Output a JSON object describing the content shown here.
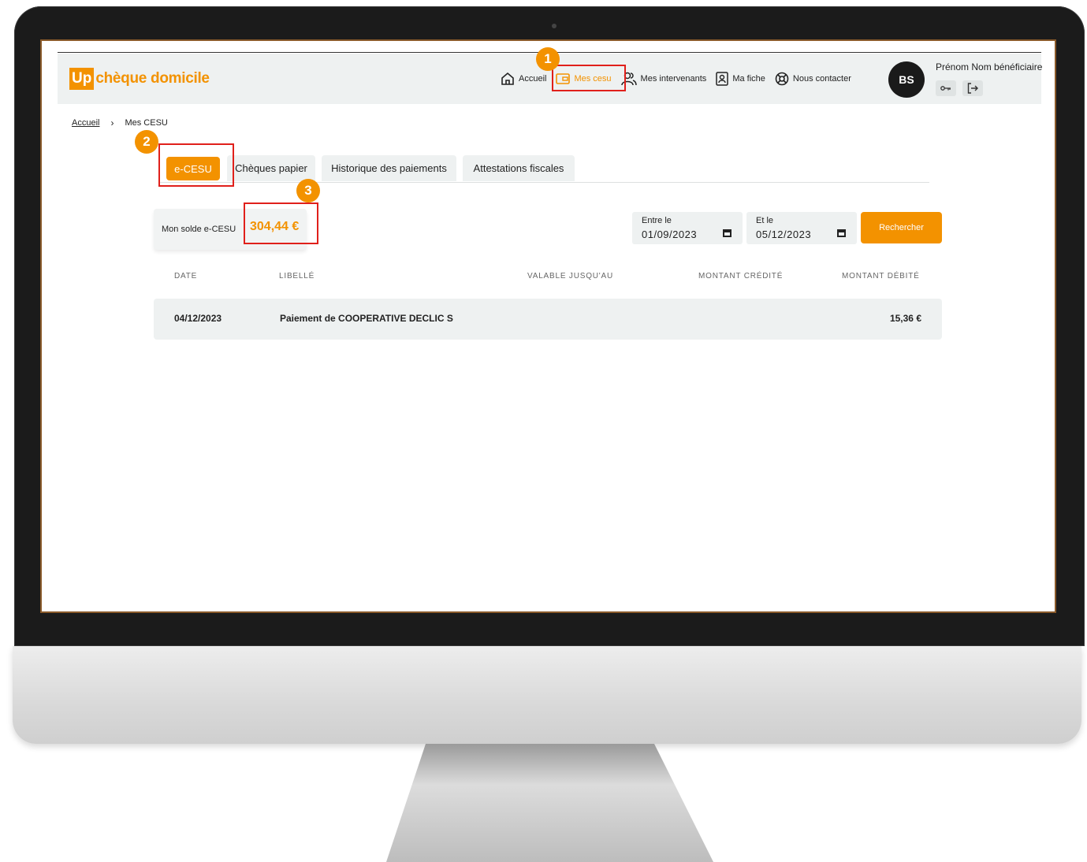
{
  "colors": {
    "accent": "#f39200",
    "header_bg": "#eef1f1",
    "annotation": "#e0201b"
  },
  "logo": {
    "up": "Up",
    "text": "chèque domicile"
  },
  "nav": [
    {
      "label": "Accueil",
      "icon": "home-icon"
    },
    {
      "label": "Mes cesu",
      "icon": "wallet-icon",
      "active": true
    },
    {
      "label": "Mes intervenants",
      "icon": "users-icon"
    },
    {
      "label": "Ma fiche",
      "icon": "contact-card-icon"
    },
    {
      "label": "Nous contacter",
      "icon": "lifebuoy-icon"
    }
  ],
  "user": {
    "initials": "BS",
    "name": "Prénom Nom bénéficiaire",
    "key_icon": "key-icon",
    "logout_icon": "logout-icon"
  },
  "breadcrumb": {
    "home": "Accueil",
    "current": "Mes CESU",
    "separator": "›"
  },
  "tabs": [
    "e-CESU",
    "Chèques papier",
    "Historique des paiements",
    "Attestations fiscales"
  ],
  "balance": {
    "label": "Mon solde e-CESU",
    "value": "304,44 €"
  },
  "filters": {
    "from_label": "Entre le",
    "from_value": "01/09/2023",
    "to_label": "Et le",
    "to_value": "05/12/2023",
    "search_label": "Rechercher"
  },
  "table": {
    "headers": [
      "DATE",
      "LIBELLÉ",
      "VALABLE JUSQU'AU",
      "MONTANT CRÉDITÉ",
      "MONTANT DÉBITÉ"
    ],
    "rows": [
      {
        "date": "04/12/2023",
        "label": "Paiement de COOPERATIVE DECLIC S",
        "valid_until": "",
        "credit": "",
        "debit": "15,36 €"
      }
    ]
  },
  "annotations": [
    "1",
    "2",
    "3"
  ]
}
